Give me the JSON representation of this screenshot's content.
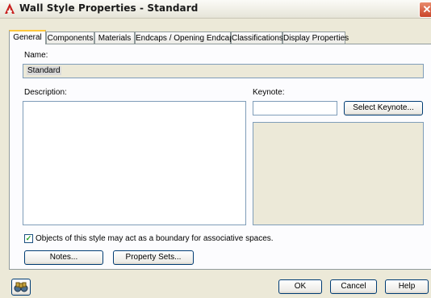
{
  "window": {
    "title": "Wall Style Properties - Standard",
    "close_glyph": "✕"
  },
  "tabs": [
    {
      "label": "General",
      "active": true
    },
    {
      "label": "Components",
      "active": false
    },
    {
      "label": "Materials",
      "active": false
    },
    {
      "label": "Endcaps / Opening Endcaps",
      "active": false
    },
    {
      "label": "Classifications",
      "active": false
    },
    {
      "label": "Display Properties",
      "active": false
    }
  ],
  "general": {
    "name_label": "Name:",
    "name_value": "Standard",
    "description_label": "Description:",
    "description_value": "",
    "keynote_label": "Keynote:",
    "keynote_value": "",
    "select_keynote_label": "Select Keynote...",
    "boundary_checkbox_label": "Objects of this style may act as a boundary for associative spaces.",
    "boundary_checked": true,
    "notes_label": "Notes...",
    "property_sets_label": "Property Sets..."
  },
  "footer": {
    "ok_label": "OK",
    "cancel_label": "Cancel",
    "help_label": "Help"
  },
  "icons": {
    "title": "autocad-architecture-icon",
    "footer": "binoculars-icon"
  },
  "colors": {
    "dialog_bg": "#ece9d8",
    "tab_active_accent": "#ffc83c",
    "close_button": "#c9452a",
    "field_border": "#7f9db9"
  }
}
